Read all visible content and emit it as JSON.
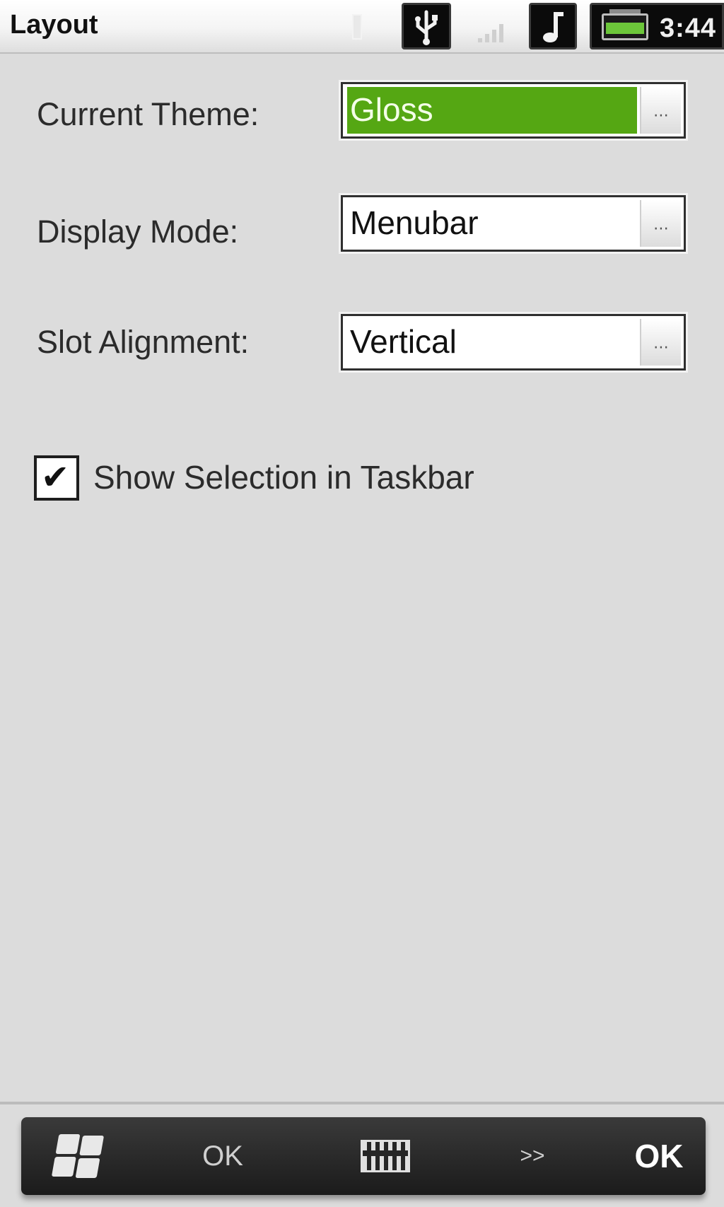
{
  "titlebar": {
    "title": "Layout",
    "clock": "3:44",
    "icons": [
      "usb-icon",
      "signal-icon",
      "music-icon",
      "battery-icon"
    ]
  },
  "form": {
    "theme": {
      "label": "Current Theme:",
      "value": "Gloss"
    },
    "display_mode": {
      "label": "Display Mode:",
      "value": "Menubar"
    },
    "slot_alignment": {
      "label": "Slot Alignment:",
      "value": "Vertical"
    },
    "show_selection": {
      "label": "Show Selection in Taskbar",
      "checked": true
    }
  },
  "softkeys": {
    "start_icon": "windows-start-icon",
    "left_label": "OK",
    "keyboard_icon": "keyboard-icon",
    "more_label": ">>",
    "right_label": "OK"
  },
  "colors": {
    "selection": "#55a713",
    "background": "#dcdcdc",
    "softbar": "#1b1b1b"
  }
}
